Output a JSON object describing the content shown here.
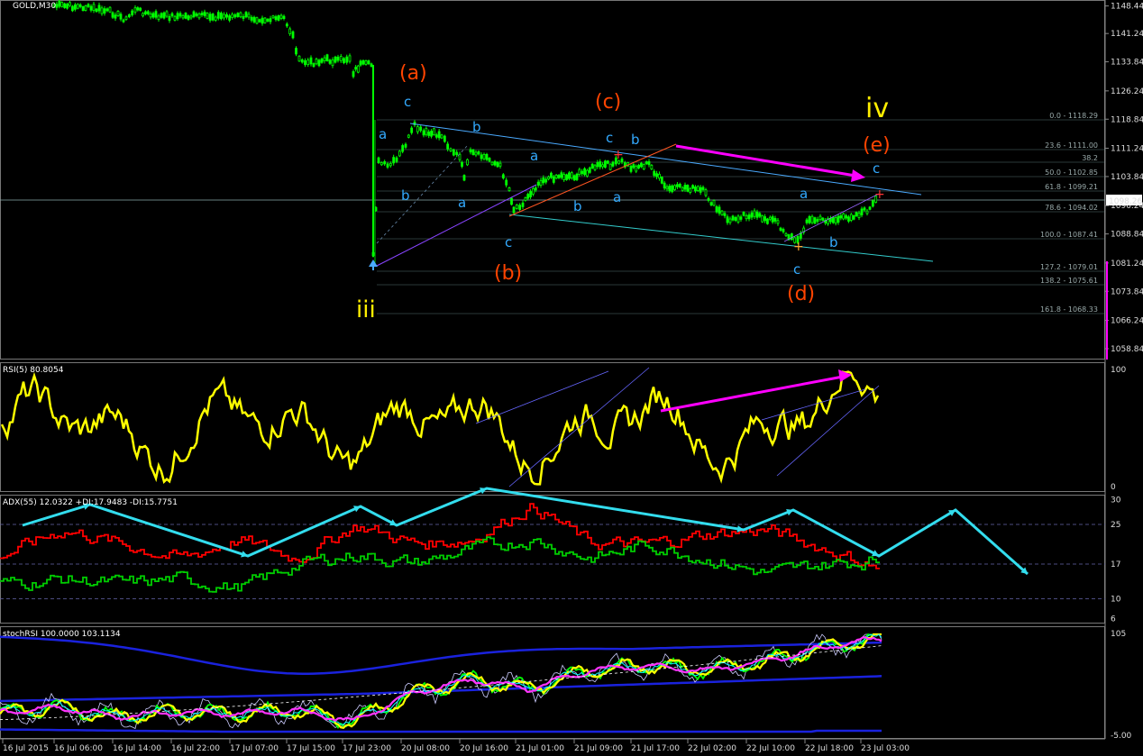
{
  "panels": {
    "price": {
      "title": "GOLD,M30",
      "y_ticks": [
        "1148.44",
        "1141.24",
        "1133.84",
        "1126.24",
        "1118.84",
        "1111.24",
        "1103.84",
        "1096.24",
        "1088.84",
        "1081.24",
        "1073.84",
        "1066.24",
        "1058.84"
      ],
      "current_price": "1098.26",
      "fib_levels": [
        "0.0 - 1118.29",
        "23.6 - 1111.00",
        "38.2",
        "50.0 - 1102.85",
        "61.8 - 1099.21",
        "78.6 - 1094.02",
        "100.0 - 1087.41",
        "127.2 - 1079.01",
        "138.2 - 1075.61",
        "161.8 - 1068.33"
      ]
    },
    "rsi": {
      "title": "RSI(5) 80.8054",
      "y_ticks": [
        "100",
        "0"
      ]
    },
    "adx": {
      "title": "ADX(55) 12.0322 +DI:17.9483 -DI:15.7751",
      "y_ticks": [
        "30",
        "25",
        "17",
        "10",
        "6"
      ]
    },
    "stoch": {
      "title": "stochRSI 100.0000 103.1134",
      "y_ticks": [
        "105",
        "-5.00"
      ]
    }
  },
  "x_ticks": [
    "16 Jul 2015",
    "16 Jul 06:00",
    "16 Jul 14:00",
    "16 Jul 22:00",
    "17 Jul 07:00",
    "17 Jul 15:00",
    "17 Jul 23:00",
    "20 Jul 08:00",
    "20 Jul 16:00",
    "21 Jul 01:00",
    "21 Jul 09:00",
    "21 Jul 17:00",
    "22 Jul 02:00",
    "22 Jul 10:00",
    "22 Jul 18:00",
    "23 Jul 03:00"
  ],
  "wave_labels": {
    "iii": "iii",
    "iv": "iv",
    "a_big": "(a)",
    "b_big": "(b)",
    "c_big": "(c)",
    "d_big": "(d)",
    "e_big": "(e)",
    "a": "a",
    "b": "b",
    "c": "c"
  },
  "colors": {
    "price": "#00ff00",
    "rsi": "#ffff00",
    "plus_di": "#00cc00",
    "minus_di": "#ff0000",
    "arrow": "#33ddee",
    "magenta": "#ff00ff",
    "orange": "#ff4400"
  },
  "chart_data": [
    {
      "type": "line",
      "title": "GOLD,M30",
      "x": [
        "16 Jul 2015",
        "16 Jul 06:00",
        "16 Jul 14:00",
        "16 Jul 22:00",
        "17 Jul 07:00",
        "17 Jul 15:00",
        "17 Jul 23:00",
        "20 Jul 08:00",
        "20 Jul 16:00",
        "21 Jul 01:00",
        "21 Jul 09:00",
        "21 Jul 17:00",
        "22 Jul 02:00",
        "22 Jul 10:00",
        "22 Jul 18:00",
        "23 Jul 03:00"
      ],
      "series": [
        {
          "values": [
            1147.5,
            1146.5,
            1145.5,
            1146.0,
            1144.0,
            1131.0,
            1132.0,
            1118.0,
            1110.0,
            1096.0,
            1108.0,
            1110.0,
            1100.0,
            1095.0,
            1090.0,
            1099.0
          ]
        }
      ],
      "ylim": [
        1056.0,
        1150.0
      ]
    },
    {
      "type": "line",
      "title": "RSI(5) 80.8054",
      "series": [
        {
          "values": [
            45,
            30,
            50,
            25,
            55,
            40,
            20,
            75,
            50,
            30,
            85,
            55,
            35,
            25,
            55,
            80
          ]
        }
      ],
      "ylim": [
        0,
        100
      ]
    },
    {
      "type": "line",
      "title": "ADX(55) 12.0322 +DI:17.9483 -DI:15.7751",
      "series": [
        {
          "name": "+DI",
          "values": [
            13,
            14,
            13,
            14,
            12,
            17,
            19,
            17,
            20,
            22,
            18,
            21,
            18,
            15,
            17,
            17.9
          ]
        },
        {
          "name": "-DI",
          "values": [
            19,
            24,
            21,
            18,
            22,
            18,
            25,
            21,
            22,
            29,
            21,
            21,
            23,
            24,
            20,
            15.8
          ]
        }
      ],
      "ylim": [
        5,
        31
      ]
    },
    {
      "type": "line",
      "title": "stochRSI 100.0000 103.1134",
      "series": [
        {
          "values": [
            20,
            25,
            15,
            20,
            18,
            22,
            10,
            40,
            55,
            45,
            65,
            70,
            65,
            75,
            90,
            100
          ]
        }
      ],
      "ylim": [
        -5,
        105
      ]
    }
  ]
}
